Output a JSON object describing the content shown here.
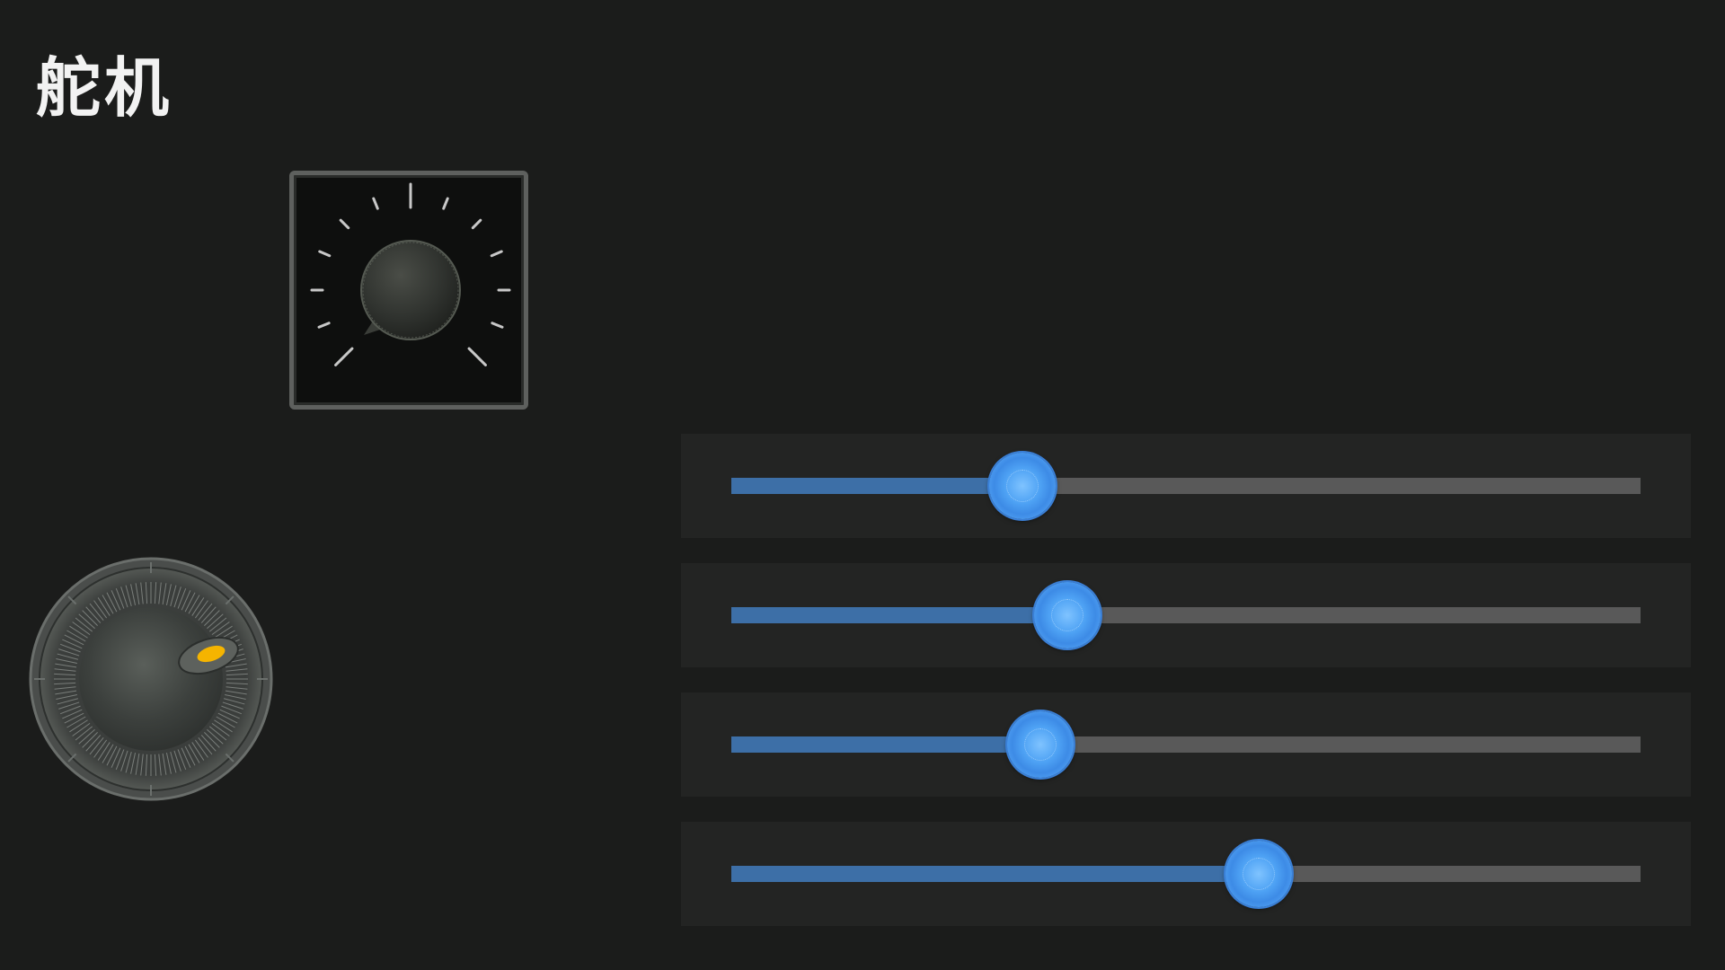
{
  "page": {
    "title": "舵机"
  },
  "colors": {
    "background": "#1b1c1b",
    "slider_fill": "#3d6fa7",
    "slider_track": "#595959",
    "slider_thumb": "#4ea2f4",
    "knob_indicator": "#f5b400"
  },
  "icons": {
    "dial": "servo-dial-icon",
    "knob": "rotary-knob-icon"
  },
  "sliders": [
    {
      "name": "servo-slider-1",
      "value": 0.32
    },
    {
      "name": "servo-slider-2",
      "value": 0.37
    },
    {
      "name": "servo-slider-3",
      "value": 0.34
    },
    {
      "name": "servo-slider-4",
      "value": 0.58
    }
  ]
}
